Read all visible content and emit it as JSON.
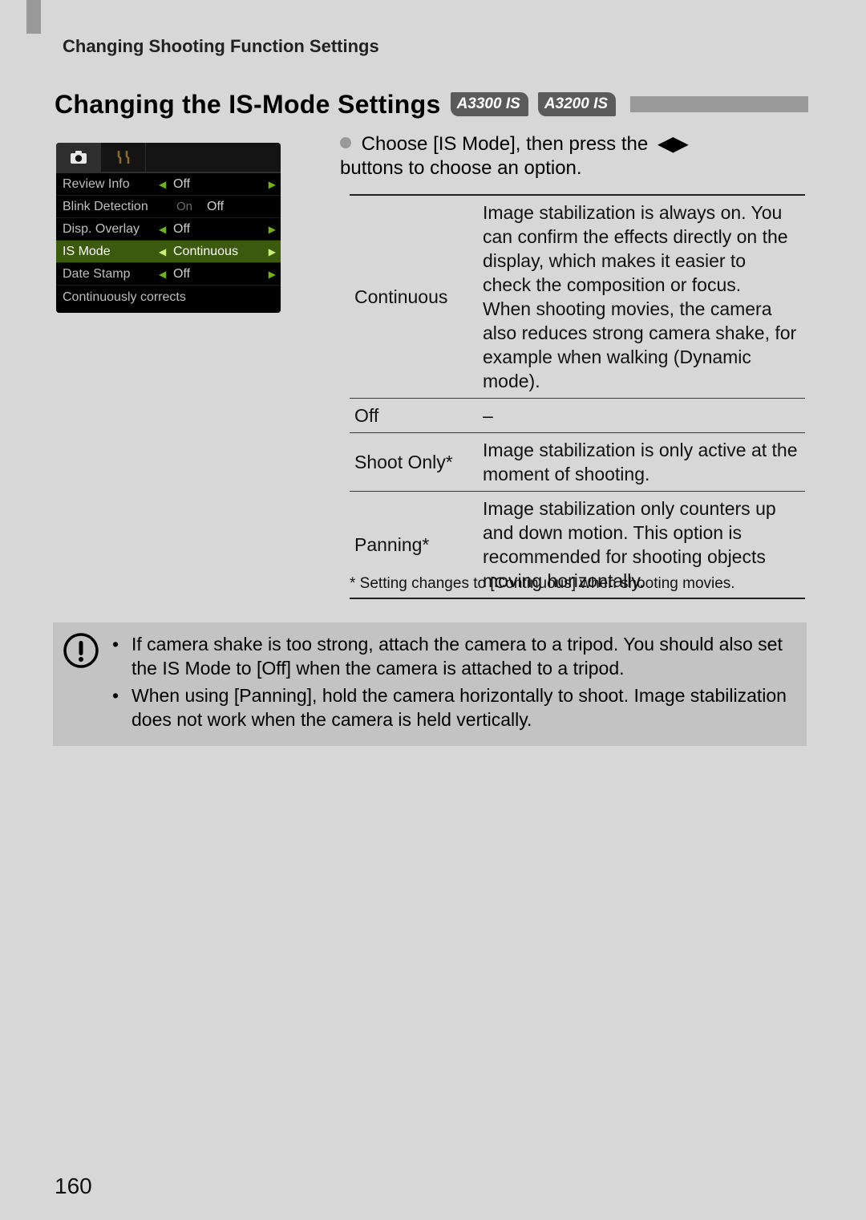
{
  "header": {
    "breadcrumb": "Changing Shooting Function Settings"
  },
  "section": {
    "title": "Changing the IS-Mode Settings",
    "model_badges": [
      "A3300 IS",
      "A3200 IS"
    ]
  },
  "camera_menu": {
    "rows": [
      {
        "label": "Review Info",
        "value": "Off",
        "has_arrows": true,
        "selected": false
      },
      {
        "label": "Blink Detection",
        "value": "Off",
        "prefix": "On",
        "has_arrows": false,
        "selected": false
      },
      {
        "label": "Disp. Overlay",
        "value": "Off",
        "has_arrows": true,
        "selected": false
      },
      {
        "label": "IS Mode",
        "value": "Continuous",
        "has_arrows": true,
        "selected": true
      },
      {
        "label": "Date Stamp",
        "value": "Off",
        "has_arrows": true,
        "selected": false
      }
    ],
    "help_text": "Continuously corrects"
  },
  "instruction": {
    "line1_a": "Choose [IS Mode], then press the ",
    "line1_b": "buttons to choose an option."
  },
  "options_table": [
    {
      "name": "Continuous",
      "desc": "Image stabilization is always on. You can confirm the effects directly on the display, which makes it easier to check the composition or focus.\nWhen shooting movies, the camera also reduces strong camera shake, for example when walking (Dynamic mode)."
    },
    {
      "name": "Off",
      "desc": "–"
    },
    {
      "name": "Shoot Only*",
      "desc": "Image stabilization is only active at the moment of shooting."
    },
    {
      "name": "Panning*",
      "desc": "Image stabilization only counters up and down motion. This option is recommended for shooting objects moving horizontally."
    }
  ],
  "footnote": "*  Setting changes to [Continuous] when shooting movies.",
  "notice": {
    "items": [
      "If camera shake is too strong, attach the camera to a tripod. You should also set the IS Mode to [Off] when the camera is attached to a tripod.",
      "When using [Panning], hold the camera horizontally to shoot. Image stabilization does not work when the camera is held vertically."
    ]
  },
  "page_number": "160"
}
